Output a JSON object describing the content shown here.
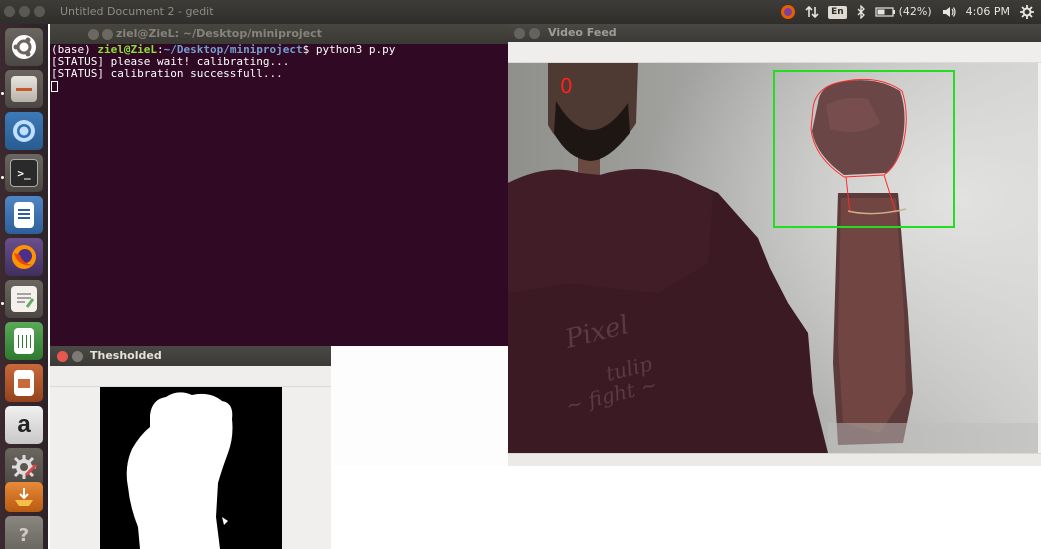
{
  "top_panel": {
    "title": "Untitled Document 2 - gedit",
    "keyboard_layout": "En",
    "battery": "(42%)",
    "clock": "4:06 PM"
  },
  "launcher": {
    "items": [
      "dash-home",
      "files",
      "chromium",
      "terminal",
      "libreoffice-writer",
      "firefox",
      "text-editor",
      "libreoffice-calc",
      "libreoffice-impress",
      "amazon",
      "system-settings",
      "software-updater",
      "trash"
    ]
  },
  "terminal": {
    "title": "ziel@ZieL: ~/Desktop/miniproject",
    "prompt_env": "(base) ",
    "prompt_user": "ziel@ZieL",
    "prompt_sep": ":",
    "prompt_path": "~/Desktop/miniproject",
    "prompt_dollar": "$ ",
    "command": "python3 p.py",
    "output": [
      "[STATUS] please wait! calibrating...",
      "[STATUS] calibration successfull..."
    ]
  },
  "video_feed": {
    "title": "Video Feed",
    "finger_count": "0",
    "roi_color": "#22dd22",
    "count_color": "#ff2020"
  },
  "threshold_window": {
    "title": "Thesholded"
  }
}
